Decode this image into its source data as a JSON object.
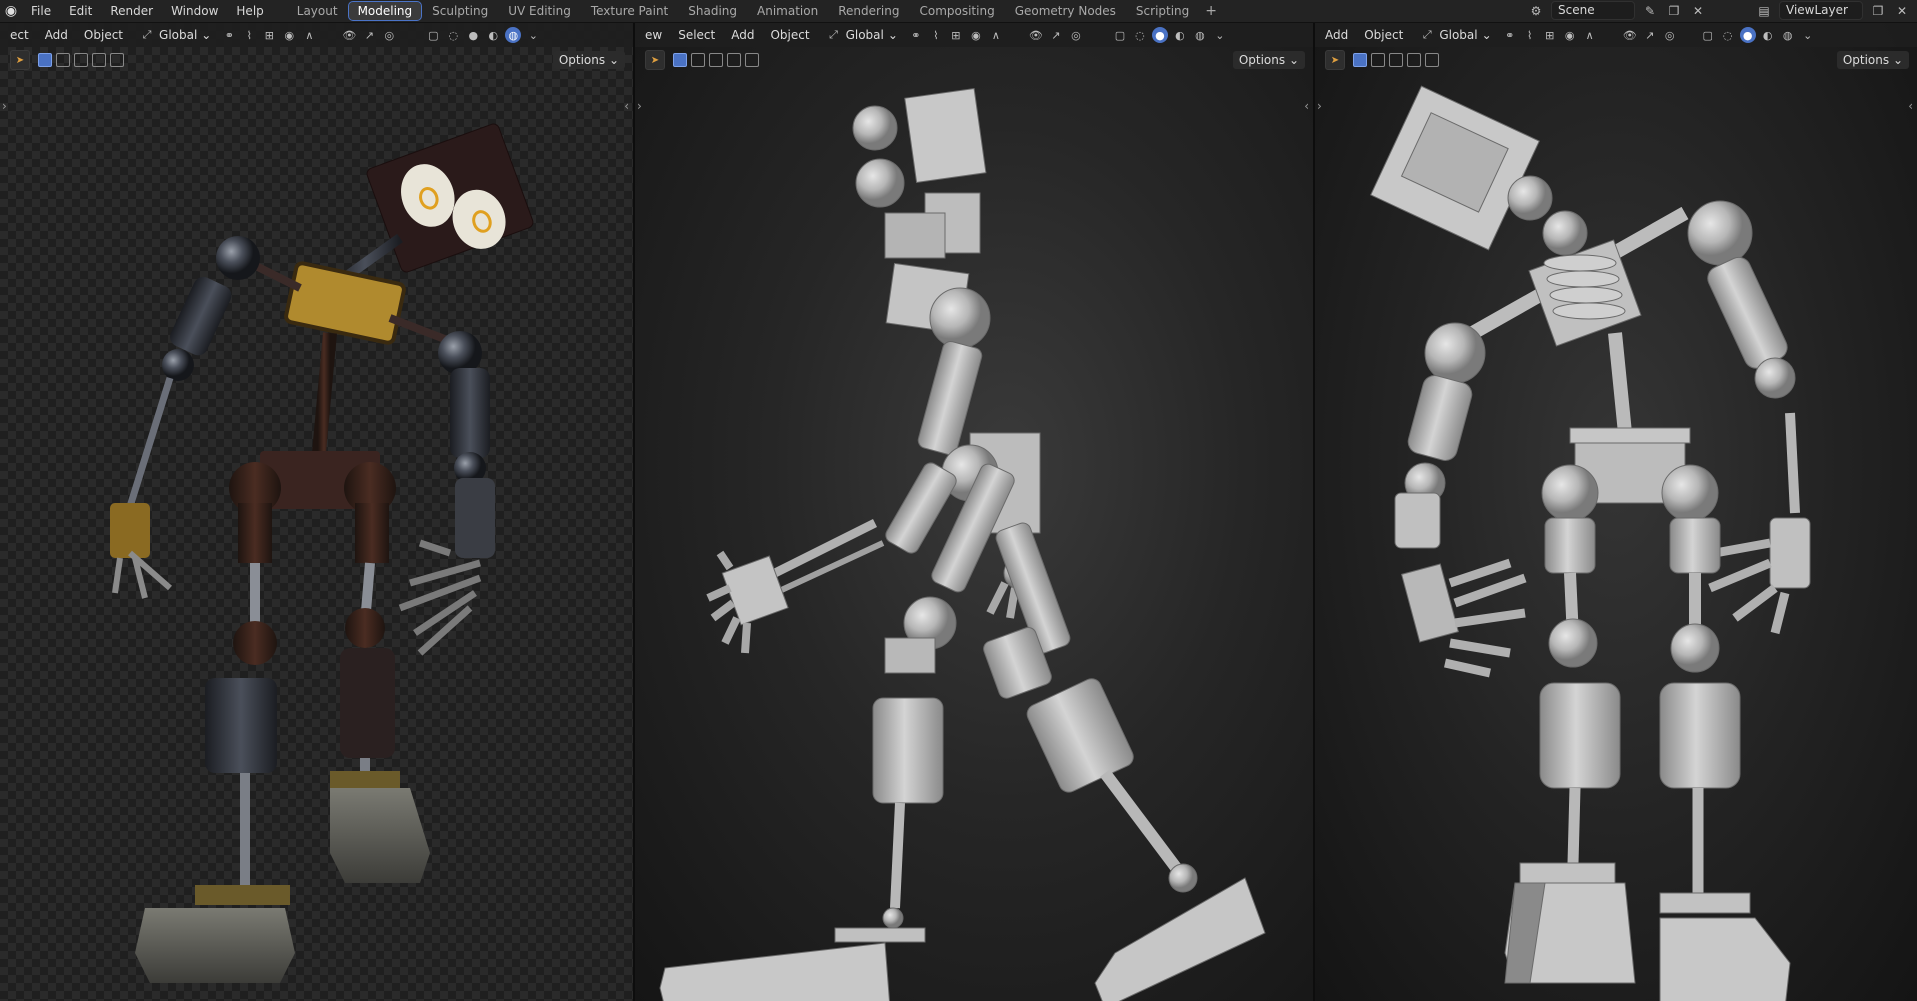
{
  "menubar": {
    "items": [
      "File",
      "Edit",
      "Render",
      "Window",
      "Help"
    ]
  },
  "workspaces": {
    "tabs": [
      "Layout",
      "Modeling",
      "Sculpting",
      "UV Editing",
      "Texture Paint",
      "Shading",
      "Animation",
      "Rendering",
      "Compositing",
      "Geometry Nodes",
      "Scripting"
    ],
    "active": "Modeling",
    "add_label": "+"
  },
  "scene": {
    "name": "Scene"
  },
  "view_layer": {
    "name": "ViewLayer"
  },
  "viewports": [
    {
      "header_labels": [
        "ect",
        "Add",
        "Object"
      ],
      "orientation": "Global",
      "options_label": "Options",
      "shading": "rendered"
    },
    {
      "header_labels": [
        "ew",
        "Select",
        "Add",
        "Object"
      ],
      "orientation": "Global",
      "options_label": "Options",
      "shading": "solid"
    },
    {
      "header_labels": [
        "Add",
        "Object"
      ],
      "orientation": "Global",
      "options_label": "Options",
      "shading": "solid"
    }
  ],
  "colors": {
    "accent": "#4a72c4",
    "solid_model": "#bcbcbc",
    "rendered_metal": "#3a3e48",
    "rendered_yellow": "#c9a23a"
  }
}
